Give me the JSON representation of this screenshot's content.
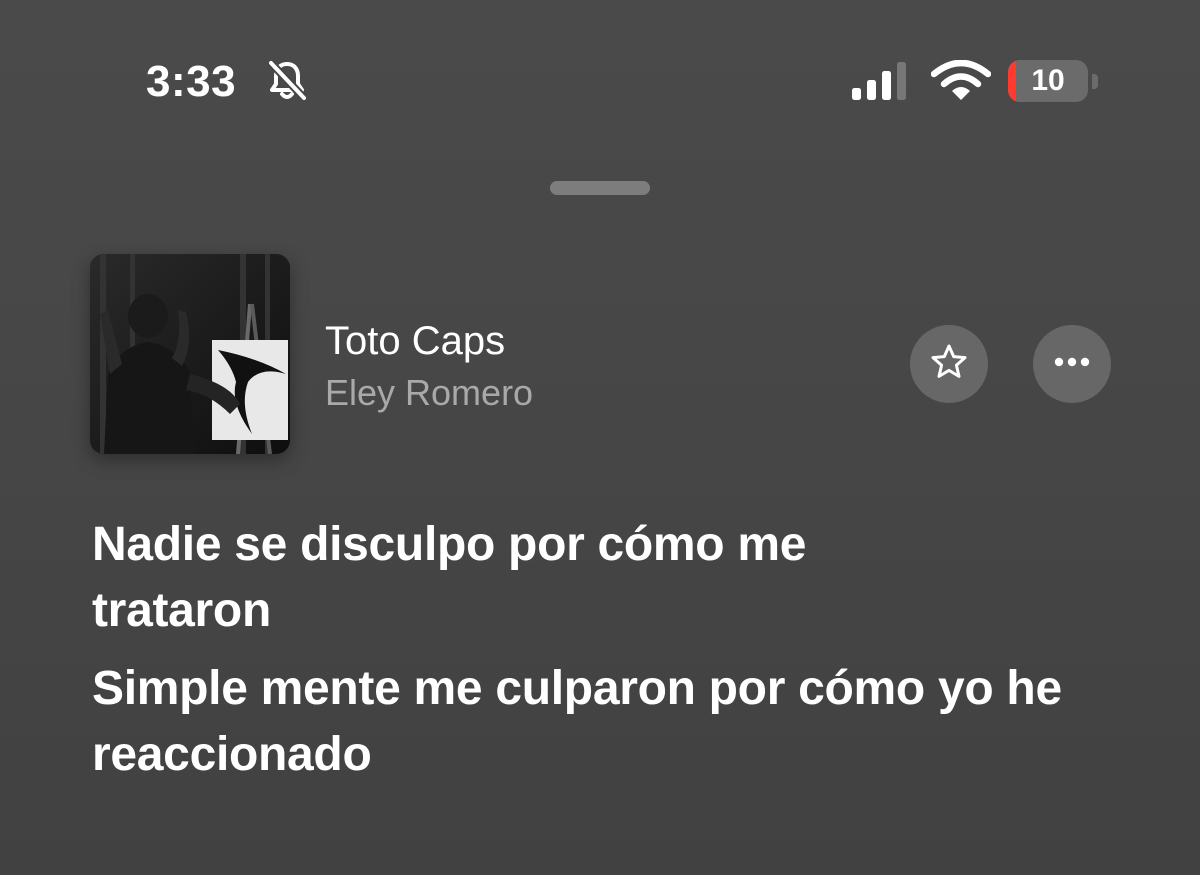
{
  "status_bar": {
    "time": "3:33",
    "mute_icon": "bell-slash-icon",
    "signal_icon": "cellular-signal-icon",
    "signal_bars_active": 3,
    "wifi_icon": "wifi-icon",
    "battery_level": "10",
    "battery_fraction": 0.1,
    "battery_low_color": "#ff3b30"
  },
  "sheet": {
    "grabber_icon": "sheet-grabber-handle"
  },
  "track": {
    "title": "Toto Caps",
    "artist": "Eley Romero",
    "artwork_icon": "album-artwork"
  },
  "actions": {
    "favorite_icon": "star-icon",
    "more_icon": "ellipsis-icon"
  },
  "lyrics": [
    "Nadie se disculpo por cómo me trataron",
    "Simple mente me culparon por cómo yo he reaccionado"
  ],
  "colors": {
    "background": "#474747",
    "secondary_text": "#a9a9a9",
    "button_fill": "#676767"
  }
}
